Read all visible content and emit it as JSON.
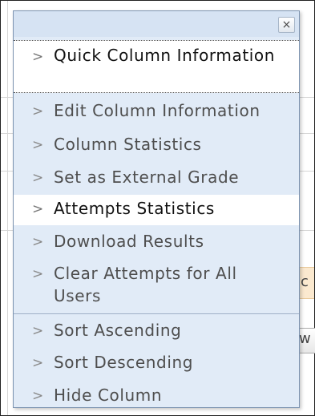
{
  "menu": {
    "close_glyph": "×",
    "chevron": ">",
    "items": [
      {
        "label": "Quick Column Information"
      },
      {
        "label": "Edit Column Information"
      },
      {
        "label": "Column Statistics"
      },
      {
        "label": "Set as External Grade"
      },
      {
        "label": "Attempts Statistics"
      },
      {
        "label": "Download Results"
      },
      {
        "label": "Clear Attempts for All Users"
      },
      {
        "label": "Sort Ascending"
      },
      {
        "label": "Sort Descending"
      },
      {
        "label": "Hide Column"
      }
    ]
  },
  "background": {
    "frag_c": "c",
    "frag_w": "w"
  },
  "colors": {
    "menu_bg": "#e1ebf7",
    "menu_border": "#7d94b1",
    "highlight_bg": "#ffffff",
    "text": "#4e4e4e"
  }
}
